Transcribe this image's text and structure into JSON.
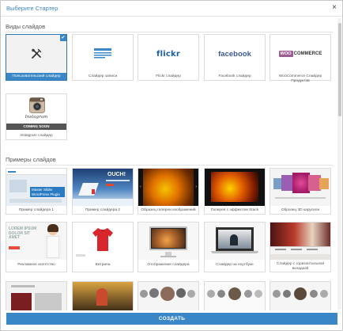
{
  "dialog": {
    "title": "Выберите Стартер",
    "close_glyph": "×"
  },
  "slide_types": {
    "heading": "Виды слайдов",
    "cards": [
      {
        "label": "Пользовательский слайдер",
        "icon": "tools-icon",
        "selected": true
      },
      {
        "label": "Слайдер записи",
        "icon": "list-icon"
      },
      {
        "label": "Flickr слайдер",
        "brand": "flickr"
      },
      {
        "label": "Facebook слайдер",
        "brand": "facebook"
      },
      {
        "label": "WooCommerce Слайдер Продуктов",
        "brand_a": "WOO",
        "brand_b": "COMMERCE"
      },
      {
        "label": "Instagram слайдер",
        "badge": "COMING SOON",
        "brand": "Instagram"
      }
    ]
  },
  "examples": {
    "heading": "Примеры слайдов",
    "cards": [
      {
        "label": "Пример слайдера 1"
      },
      {
        "label": "Пример слайдера 2"
      },
      {
        "label": "Образец галереи изображений"
      },
      {
        "label": "Галерея с эффектом Stack"
      },
      {
        "label": "Образец 3D карусели"
      },
      {
        "label": "Рекламное агентство"
      },
      {
        "label": "Витрина"
      },
      {
        "label": "Отображение слайдера"
      },
      {
        "label": "Слайдер на ноутбуке"
      },
      {
        "label": "Слайдер с горизонтальной вкладкой"
      }
    ],
    "thumb_texts": {
      "ex1_badge": "Master Slider WordPress Plugin",
      "ex2_word": "OUCH!",
      "ex6_lines": "LOREM IPSUM DOLOR SIT AMET"
    }
  },
  "footer": {
    "create_label": "СОЗДАТЬ"
  },
  "colors": {
    "accent": "#3a87c8",
    "woo_purple": "#9b5c8f",
    "facebook": "#3b5998",
    "flickr": "#1a5fa8"
  }
}
